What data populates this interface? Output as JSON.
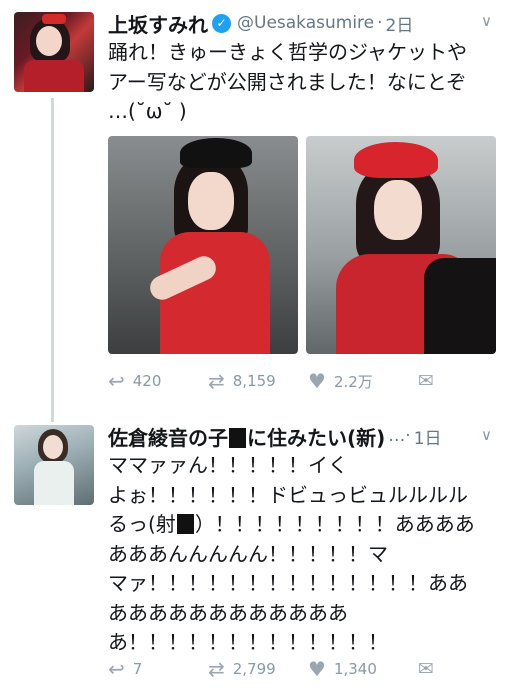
{
  "tweets": [
    {
      "name": "上坂すみれ",
      "handle": "@Uesakasumire",
      "separator": "·",
      "time": "2日",
      "text_lines": [
        "踊れ！きゅーきょく哲学のジャケットや",
        "アー写などが公開されました！なにとぞ",
        "…(˘ω˘ )"
      ],
      "verified_icon": "verified-check-icon",
      "photos": [
        "photo-black-beret-red-dress",
        "photo-red-beret-black-jacket"
      ],
      "reply_count": "420",
      "retweet_count": "8,159",
      "like_count": "2.2万"
    },
    {
      "name_parts": [
        "佐倉綾音の子",
        "に住みたい(新)"
      ],
      "separator": "…·",
      "time": "1日",
      "text_lines": [
        [
          "ママァァん！！！！！イく"
        ],
        [
          "よぉ！！！！！！ドビュっビュルルルル"
        ],
        [
          "るっ(射",
          "）！！！！！！！！！ああああ"
        ],
        [
          "あああんんんんん！！！！！マ"
        ],
        [
          "マァ！！！！！！！！！！！！！！ああ"
        ],
        [
          "ああああああああああああ"
        ],
        [
          "あ！！！！！！！！！！！！！"
        ]
      ],
      "reply_count": "7",
      "retweet_count": "2,799",
      "like_count": "1,340"
    }
  ],
  "icons": {
    "reply": "↩",
    "retweet": "⇄",
    "like": "♥",
    "dm": "✉",
    "chevron": "∨",
    "check": "✓"
  },
  "colors": {
    "verified": "#1da1f2",
    "muted": "#657786",
    "thread_line": "#cfd9de"
  }
}
